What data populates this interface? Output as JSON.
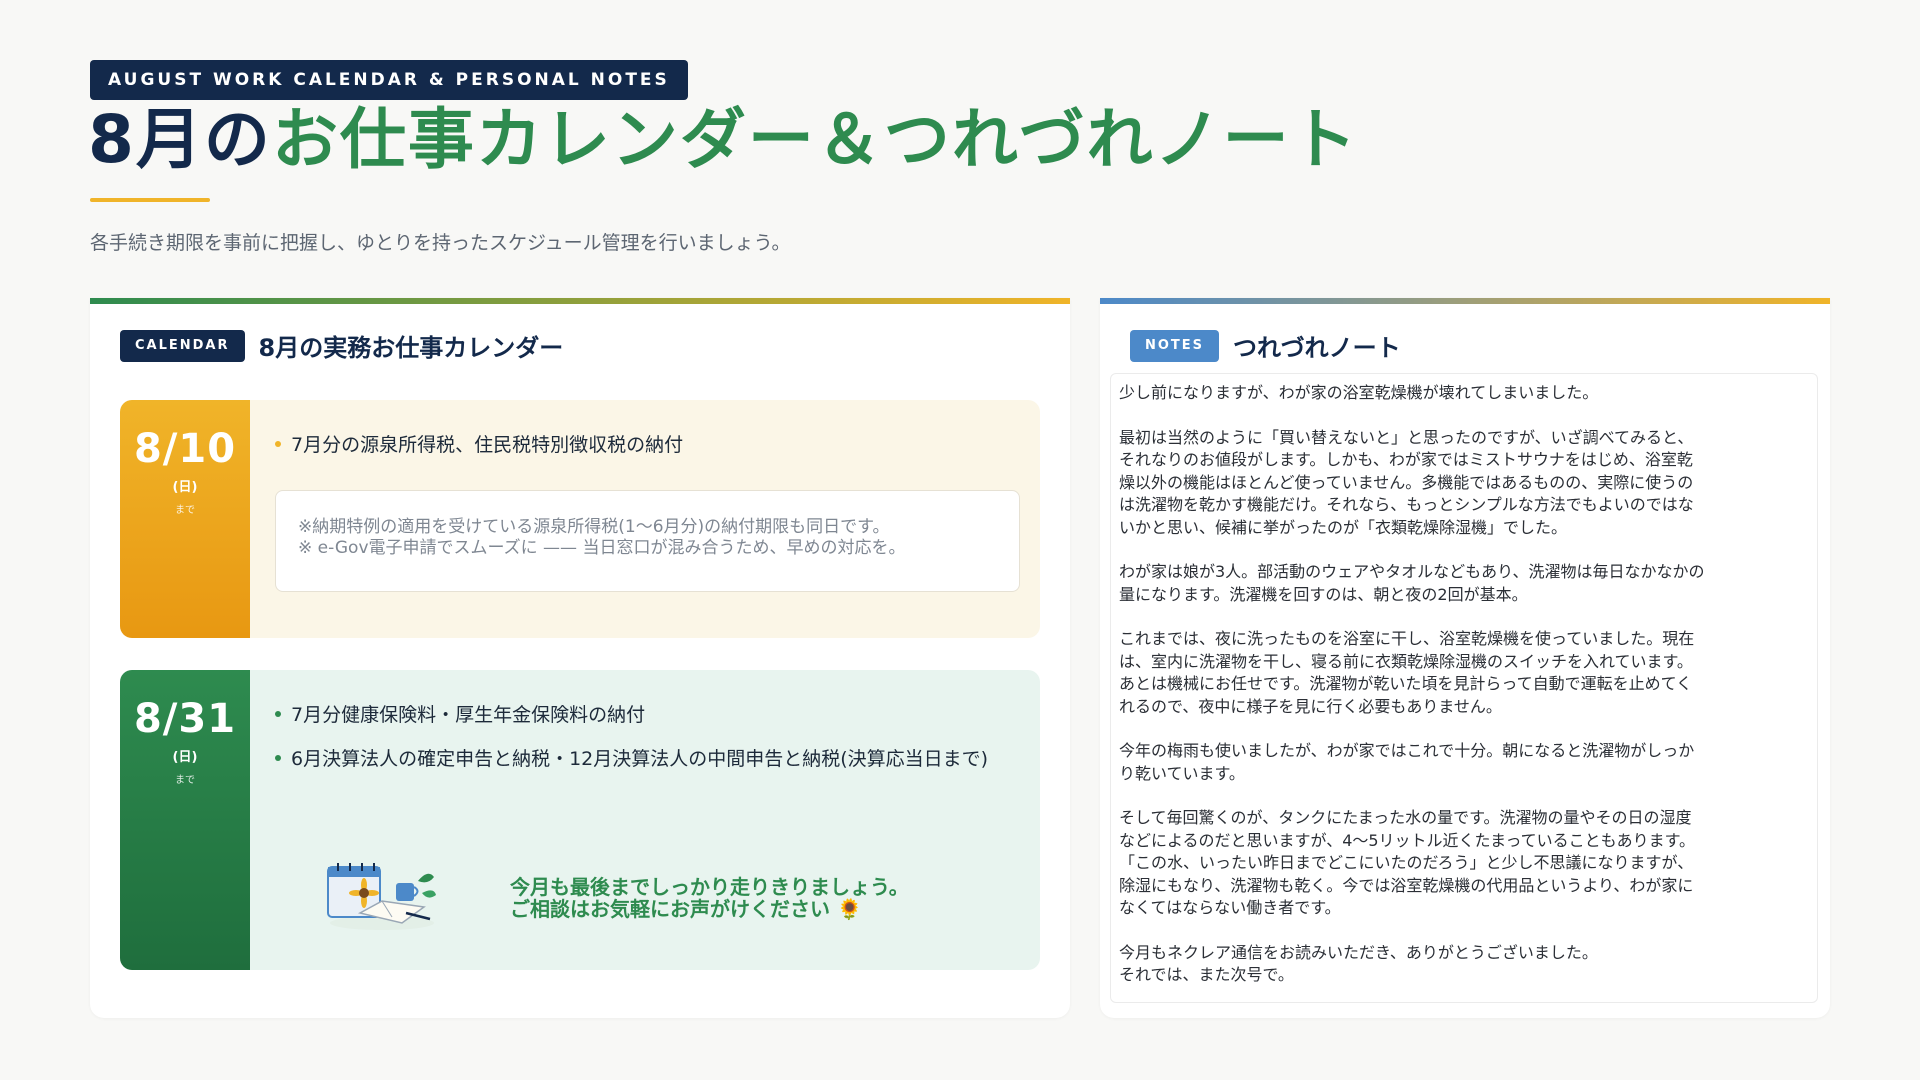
{
  "header": {
    "tag": "AUGUST WORK CALENDAR & PERSONAL NOTES",
    "title_part1": "8月の",
    "title_part2": "お仕事カレンダー＆つれづれノート",
    "subtitle": "各手続き期限を事前に把握し、ゆとりを持ったスケジュール管理を行いましょう。"
  },
  "calendar": {
    "badge": "CALENDAR",
    "title": "8月の実務お仕事カレンダー",
    "events": [
      {
        "date": "8/10",
        "dow": "(日)",
        "suffix": "まで",
        "items": [
          "7月分の源泉所得税、住民税特別徴収税の納付"
        ],
        "note_lines": [
          "※納期特例の適用を受けている源泉所得税(1〜6月分)の納付期限も同日です。",
          "※ e-Gov電子申請でスムーズに —— 当日窓口が混み合うため、早めの対応を。"
        ]
      },
      {
        "date": "8/31",
        "dow": "(日)",
        "suffix": "まで",
        "items": [
          "7月分健康保険料・厚生年金保険料の納付",
          "6月決算法人の確定申告と納税・12月決算法人の中間申告と納税(決算応当日まで)"
        ],
        "closing_lines": [
          "今月も最後までしっかり走りきりましょう。",
          "ご相談はお気軽にお声がけください 🌻"
        ]
      }
    ]
  },
  "notes": {
    "badge": "NOTES",
    "title": "つれづれノート",
    "paragraphs": [
      [
        "少し前になりますが、わが家の浴室乾燥機が壊れてしまいました。"
      ],
      [
        "最初は当然のように「買い替えないと」と思ったのですが、いざ調べてみると、",
        "それなりのお値段がします。しかも、わが家ではミストサウナをはじめ、浴室乾",
        "燥以外の機能はほとんど使っていません。多機能ではあるものの、実際に使うの",
        "は洗濯物を乾かす機能だけ。それなら、もっとシンプルな方法でもよいのではな",
        "いかと思い、候補に挙がったのが「衣類乾燥除湿機」でした。"
      ],
      [
        "わが家は娘が3人。部活動のウェアやタオルなどもあり、洗濯物は毎日なかなかの",
        "量になります。洗濯機を回すのは、朝と夜の2回が基本。"
      ],
      [
        "これまでは、夜に洗ったものを浴室に干し、浴室乾燥機を使っていました。現在",
        "は、室内に洗濯物を干し、寝る前に衣類乾燥除湿機のスイッチを入れています。",
        "あとは機械にお任せです。洗濯物が乾いた頃を見計らって自動で運転を止めてく",
        "れるので、夜中に様子を見に行く必要もありません。"
      ],
      [
        "今年の梅雨も使いましたが、わが家ではこれで十分。朝になると洗濯物がしっか",
        "り乾いています。"
      ],
      [
        "そして毎回驚くのが、タンクにたまった水の量です。洗濯物の量やその日の湿度",
        "などによるのだと思いますが、4〜5リットル近くたまっていることもあります。",
        "「この水、いったい昨日までどこにいたのだろう」と少し不思議になりますが、",
        "除湿にもなり、洗濯物も乾く。今では浴室乾燥機の代用品というより、わが家に",
        "なくてはならない働き者です。"
      ],
      [
        "今月もネクレア通信をお読みいただき、ありがとうございました。",
        "それでは、また次号で。"
      ]
    ]
  },
  "colors": {
    "navy": "#13294b",
    "green": "#2e8b4f",
    "gold": "#f0b429",
    "blue": "#4c89c9"
  }
}
